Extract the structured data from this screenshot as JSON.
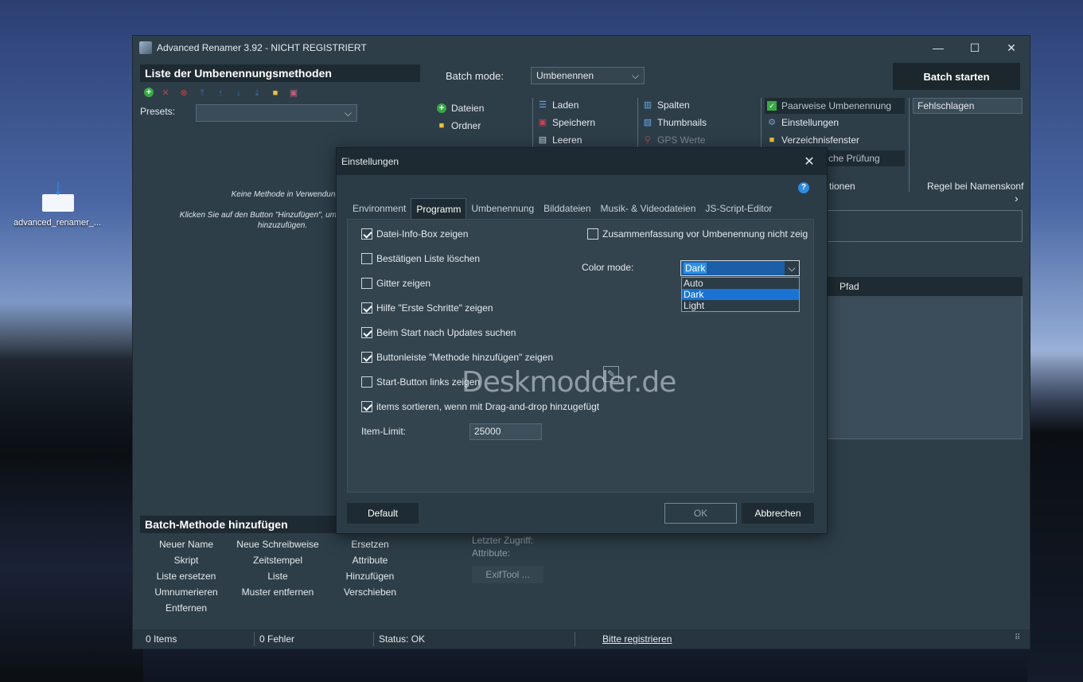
{
  "desktop": {
    "icon_label": "advanced_renamer_..."
  },
  "window": {
    "title": "Advanced Renamer 3.92 - NICHT REGISTRIERT",
    "controls": {
      "minimize": "—",
      "maximize": "☐",
      "close": "✕"
    }
  },
  "methods_panel": {
    "header": "Liste der Umbenennungsmethoden",
    "presets_label": "Presets:",
    "presets_value": "",
    "empty_line1": "Keine Methode in Verwendung",
    "empty_line2": "Klicken Sie auf den Button \"Hinzufügen\", um",
    "empty_line3": "hinzuzufügen.",
    "toolbar_icons": [
      "add-icon",
      "remove-icon",
      "clear-icon",
      "move-top-icon",
      "move-up-icon",
      "move-down-icon",
      "move-bottom-icon",
      "folder-icon",
      "save-icon"
    ]
  },
  "batch": {
    "mode_label": "Batch mode:",
    "mode_value": "Umbenennen",
    "start_button": "Batch starten"
  },
  "menu": {
    "dateien": "Dateien",
    "ordner": "Ordner",
    "laden": "Laden",
    "speichern": "Speichern",
    "leeren": "Leeren",
    "spalten": "Spalten",
    "thumbnails": "Thumbnails",
    "gps": "GPS Werte",
    "paarweise": "Paarweise Umbenennung",
    "einstellungen": "Einstellungen",
    "verzeichnis": "Verzeichnisfenster",
    "pruefung": "che Prüfung",
    "optionen": "tionen",
    "fehl_value": "Fehlschlagen",
    "regel": "Regel bei Namenskonf",
    "regel_arrow": "›"
  },
  "grid": {
    "col_pfad": "Pfad"
  },
  "batch_methods": {
    "header": "Batch-Methode hinzufügen",
    "items": [
      "Neuer Name",
      "Neue Schreibweise",
      "Ersetzen",
      "Skript",
      "Zeitstempel",
      "Attribute",
      "Liste ersetzen",
      "Liste",
      "Hinzufügen",
      "Umnumerieren",
      "Muster entfernen",
      "Verschieben",
      "Entfernen"
    ]
  },
  "info": {
    "last_access": "Letzter Zugriff:",
    "attributes": "Attribute:",
    "exiftool": "ExifTool ..."
  },
  "status": {
    "items": "0 Items",
    "errors": "0 Fehler",
    "status": "Status: OK",
    "register": "Bitte registrieren",
    "grip": "⠿"
  },
  "dialog": {
    "title": "Einstellungen",
    "close": "✕",
    "help": "?",
    "tabs": [
      "Environment",
      "Programm",
      "Umbenennung",
      "Bilddateien",
      "Musik- & Videodateien",
      "JS-Script-Editor"
    ],
    "checks": [
      {
        "label": "Datei-Info-Box zeigen",
        "checked": true
      },
      {
        "label": "Bestätigen Liste löschen",
        "checked": false
      },
      {
        "label": "Gitter zeigen",
        "checked": false
      },
      {
        "label": "Hilfe \"Erste Schritte\" zeigen",
        "checked": true
      },
      {
        "label": "Beim Start nach Updates suchen",
        "checked": true
      },
      {
        "label": "Buttonleiste \"Methode hinzufügen\" zeigen",
        "checked": true
      },
      {
        "label": "Start-Button links zeigen",
        "checked": false
      },
      {
        "label": "items sortieren, wenn mit Drag-and-drop hinzugefügt",
        "checked": true
      }
    ],
    "summary_check": {
      "label": "Zusammenfassung vor Umbenennung nicht zeig",
      "checked": false
    },
    "item_limit_label": "Item-Limit:",
    "item_limit_value": "25000",
    "color_mode_label": "Color mode:",
    "color_mode_value": "Dark",
    "color_mode_options": [
      "Auto",
      "Dark",
      "Light"
    ],
    "buttons": {
      "default": "Default",
      "ok": "OK",
      "cancel": "Abbrechen"
    }
  },
  "watermark": "Deskmodder.de",
  "colors": {
    "window_bg": "#2d3e49",
    "header_bg": "#1e2a32",
    "accent": "#2f8fe0",
    "selection": "#1a73d4"
  }
}
